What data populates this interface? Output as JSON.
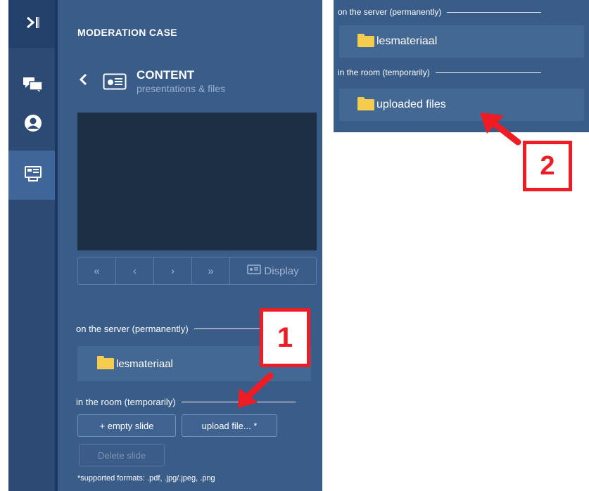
{
  "header": {
    "title": "MODERATION CASE"
  },
  "content": {
    "title": "CONTENT",
    "subtitle": "presentations & files"
  },
  "nav": {
    "first": "«",
    "prev": "‹",
    "next": "›",
    "last": "»",
    "display": "Display"
  },
  "server": {
    "label": "on the server (permanently)",
    "folder": "lesmateriaal"
  },
  "room": {
    "label": "in the room (temporarily)",
    "empty_slide": "+ empty slide",
    "upload": "upload file... *",
    "delete": "Delete slide"
  },
  "note": "*supported formats: .pdf, .jpg/.jpeg, .png",
  "callouts": {
    "one": "1",
    "two": "2"
  },
  "zoom": {
    "server_label": "on the server (permanently)",
    "server_folder": "lesmateriaal",
    "room_label": "in the room (temporarily)",
    "room_folder": "uploaded files"
  },
  "icons": {
    "collapse": "sidebar-collapse-icon",
    "chat": "chat-icon",
    "user": "user-icon",
    "content": "content-icon",
    "back": "chevron-left-icon",
    "folder": "folder-icon"
  },
  "colors": {
    "panel": "#3a5c89",
    "sidebar": "#2c4a73",
    "accent_red": "#ee1c24",
    "folder": "#f5cd4e"
  }
}
